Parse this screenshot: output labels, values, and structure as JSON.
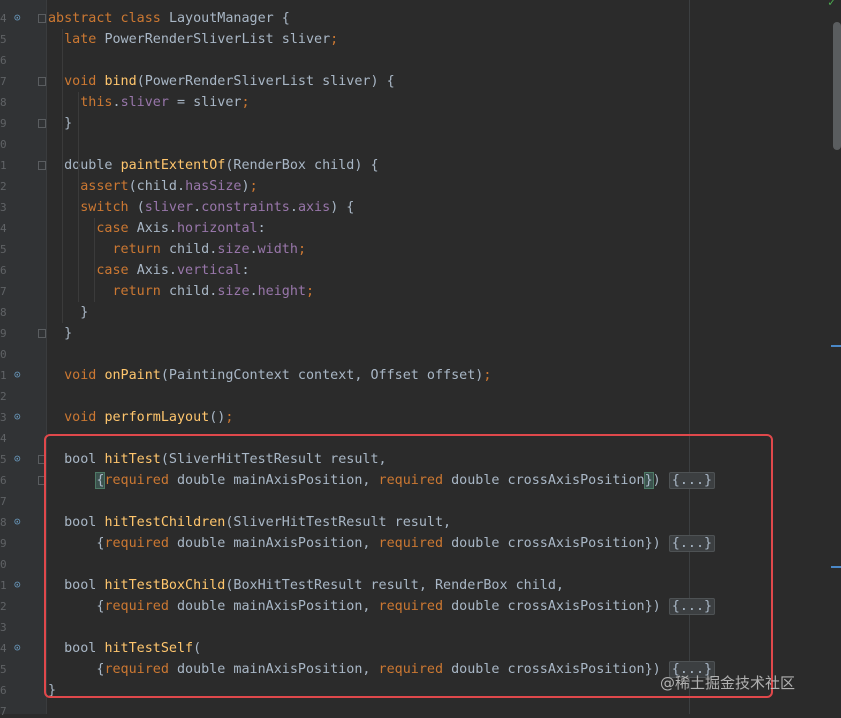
{
  "line_numbers": [
    "4",
    "5",
    "6",
    "7",
    "8",
    "9",
    "0",
    "1",
    "2",
    "3",
    "4",
    "5",
    "6",
    "7",
    "8",
    "9",
    "0",
    "1",
    "2",
    "3",
    "4",
    "5",
    "6",
    "7",
    "8",
    "9",
    "0",
    "1",
    "2",
    "3",
    "4",
    "5",
    "6",
    "7"
  ],
  "code_lines": [
    [
      {
        "t": "abstract class LayoutManager {",
        "c": "kw-mixed",
        "parts": [
          {
            "t": "abstract class ",
            "c": "kw"
          },
          {
            "t": "LayoutManager {",
            "c": "plain"
          }
        ]
      }
    ],
    [
      {
        "t": "  "
      },
      {
        "t": "late ",
        "c": "kw"
      },
      {
        "t": "PowerRenderSliverList sliver",
        "c": "plain"
      },
      {
        "t": ";",
        "c": "kw"
      }
    ],
    [],
    [
      {
        "t": "  "
      },
      {
        "t": "void ",
        "c": "kw"
      },
      {
        "t": "bind",
        "c": "fn"
      },
      {
        "t": "(PowerRenderSliverList sliver) {",
        "c": "plain"
      }
    ],
    [
      {
        "t": "    "
      },
      {
        "t": "this",
        "c": "kw"
      },
      {
        "t": ".",
        "c": "plain"
      },
      {
        "t": "sliver",
        "c": "fld"
      },
      {
        "t": " = sliver",
        "c": "plain"
      },
      {
        "t": ";",
        "c": "kw"
      }
    ],
    [
      {
        "t": "  }",
        "c": "plain"
      }
    ],
    [],
    [
      {
        "t": "  "
      },
      {
        "t": "double ",
        "c": "plain"
      },
      {
        "t": "paintExtentOf",
        "c": "fn"
      },
      {
        "t": "(RenderBox child) {",
        "c": "plain"
      }
    ],
    [
      {
        "t": "    "
      },
      {
        "t": "assert",
        "c": "kw"
      },
      {
        "t": "(child.",
        "c": "plain"
      },
      {
        "t": "hasSize",
        "c": "fld"
      },
      {
        "t": ")",
        "c": "plain"
      },
      {
        "t": ";",
        "c": "kw"
      }
    ],
    [
      {
        "t": "    "
      },
      {
        "t": "switch ",
        "c": "kw"
      },
      {
        "t": "(",
        "c": "plain"
      },
      {
        "t": "sliver",
        "c": "fld"
      },
      {
        "t": ".",
        "c": "plain"
      },
      {
        "t": "constraints",
        "c": "fld"
      },
      {
        "t": ".",
        "c": "plain"
      },
      {
        "t": "axis",
        "c": "fld"
      },
      {
        "t": ") {",
        "c": "plain"
      }
    ],
    [
      {
        "t": "      "
      },
      {
        "t": "case ",
        "c": "kw"
      },
      {
        "t": "Axis.",
        "c": "plain"
      },
      {
        "t": "horizontal",
        "c": "fld"
      },
      {
        "t": ":",
        "c": "plain"
      }
    ],
    [
      {
        "t": "        "
      },
      {
        "t": "return ",
        "c": "kw"
      },
      {
        "t": "child.",
        "c": "plain"
      },
      {
        "t": "size",
        "c": "fld"
      },
      {
        "t": ".",
        "c": "plain"
      },
      {
        "t": "width",
        "c": "fld"
      },
      {
        "t": ";",
        "c": "kw"
      }
    ],
    [
      {
        "t": "      "
      },
      {
        "t": "case ",
        "c": "kw"
      },
      {
        "t": "Axis.",
        "c": "plain"
      },
      {
        "t": "vertical",
        "c": "fld"
      },
      {
        "t": ":",
        "c": "plain"
      }
    ],
    [
      {
        "t": "        "
      },
      {
        "t": "return ",
        "c": "kw"
      },
      {
        "t": "child.",
        "c": "plain"
      },
      {
        "t": "size",
        "c": "fld"
      },
      {
        "t": ".",
        "c": "plain"
      },
      {
        "t": "height",
        "c": "fld"
      },
      {
        "t": ";",
        "c": "kw"
      }
    ],
    [
      {
        "t": "    }",
        "c": "plain"
      }
    ],
    [
      {
        "t": "  }",
        "c": "plain"
      }
    ],
    [],
    [
      {
        "t": "  "
      },
      {
        "t": "void ",
        "c": "kw"
      },
      {
        "t": "onPaint",
        "c": "fn"
      },
      {
        "t": "(PaintingContext context, Offset offset)",
        "c": "plain"
      },
      {
        "t": ";",
        "c": "kw"
      }
    ],
    [],
    [
      {
        "t": "  "
      },
      {
        "t": "void ",
        "c": "kw"
      },
      {
        "t": "performLayout",
        "c": "fn"
      },
      {
        "t": "()",
        "c": "plain"
      },
      {
        "t": ";",
        "c": "kw"
      }
    ],
    [],
    [
      {
        "t": "  "
      },
      {
        "t": "bool ",
        "c": "plain"
      },
      {
        "t": "hitTest",
        "c": "fn"
      },
      {
        "t": "(SliverHitTestResult result,",
        "c": "plain"
      }
    ],
    [
      {
        "t": "      "
      },
      {
        "t": "{",
        "c": "hl"
      },
      {
        "t": "required ",
        "c": "kw"
      },
      {
        "t": "double mainAxisPosition, ",
        "c": "plain"
      },
      {
        "t": "required ",
        "c": "kw"
      },
      {
        "t": "double crossAxisPosition",
        "c": "plain"
      },
      {
        "t": "}",
        "c": "hl"
      },
      {
        "t": ") ",
        "c": "plain"
      },
      {
        "t": "{...}",
        "c": "ph"
      }
    ],
    [],
    [
      {
        "t": "  "
      },
      {
        "t": "bool ",
        "c": "plain"
      },
      {
        "t": "hitTestChildren",
        "c": "fn"
      },
      {
        "t": "(SliverHitTestResult result,",
        "c": "plain"
      }
    ],
    [
      {
        "t": "      "
      },
      {
        "t": "{",
        "c": "plain"
      },
      {
        "t": "required ",
        "c": "kw"
      },
      {
        "t": "double mainAxisPosition, ",
        "c": "plain"
      },
      {
        "t": "required ",
        "c": "kw"
      },
      {
        "t": "double crossAxisPosition})",
        "c": "plain"
      },
      {
        "t": " "
      },
      {
        "t": "{...}",
        "c": "ph"
      }
    ],
    [],
    [
      {
        "t": "  "
      },
      {
        "t": "bool ",
        "c": "plain"
      },
      {
        "t": "hitTestBoxChild",
        "c": "fn"
      },
      {
        "t": "(BoxHitTestResult result, RenderBox child,",
        "c": "plain"
      }
    ],
    [
      {
        "t": "      "
      },
      {
        "t": "{",
        "c": "plain"
      },
      {
        "t": "required ",
        "c": "kw"
      },
      {
        "t": "double mainAxisPosition, ",
        "c": "plain"
      },
      {
        "t": "required ",
        "c": "kw"
      },
      {
        "t": "double crossAxisPosition})",
        "c": "plain"
      },
      {
        "t": " "
      },
      {
        "t": "{...}",
        "c": "ph"
      }
    ],
    [],
    [
      {
        "t": "  "
      },
      {
        "t": "bool ",
        "c": "plain"
      },
      {
        "t": "hitTestSelf",
        "c": "fn"
      },
      {
        "t": "(",
        "c": "plain"
      }
    ],
    [
      {
        "t": "      "
      },
      {
        "t": "{",
        "c": "plain"
      },
      {
        "t": "required ",
        "c": "kw"
      },
      {
        "t": "double mainAxisPosition, ",
        "c": "plain"
      },
      {
        "t": "required ",
        "c": "kw"
      },
      {
        "t": "double crossAxisPosition})",
        "c": "plain"
      },
      {
        "t": " "
      },
      {
        "t": "{...}",
        "c": "ph"
      }
    ],
    [
      {
        "t": "}",
        "c": "plain"
      }
    ],
    []
  ],
  "watermark": "@稀土掘金技术社区",
  "gutter_icons": {
    "0": "override-icon",
    "17": "implement-icon",
    "19": "implement-icon",
    "21": "override-icon",
    "24": "implement-icon",
    "27": "override-icon",
    "30": "implement-icon"
  },
  "colors": {
    "keyword": "#cc7832",
    "function": "#ffc66d",
    "field": "#9876aa",
    "text": "#a9b7c6",
    "highlight_box": "#e0484b"
  }
}
